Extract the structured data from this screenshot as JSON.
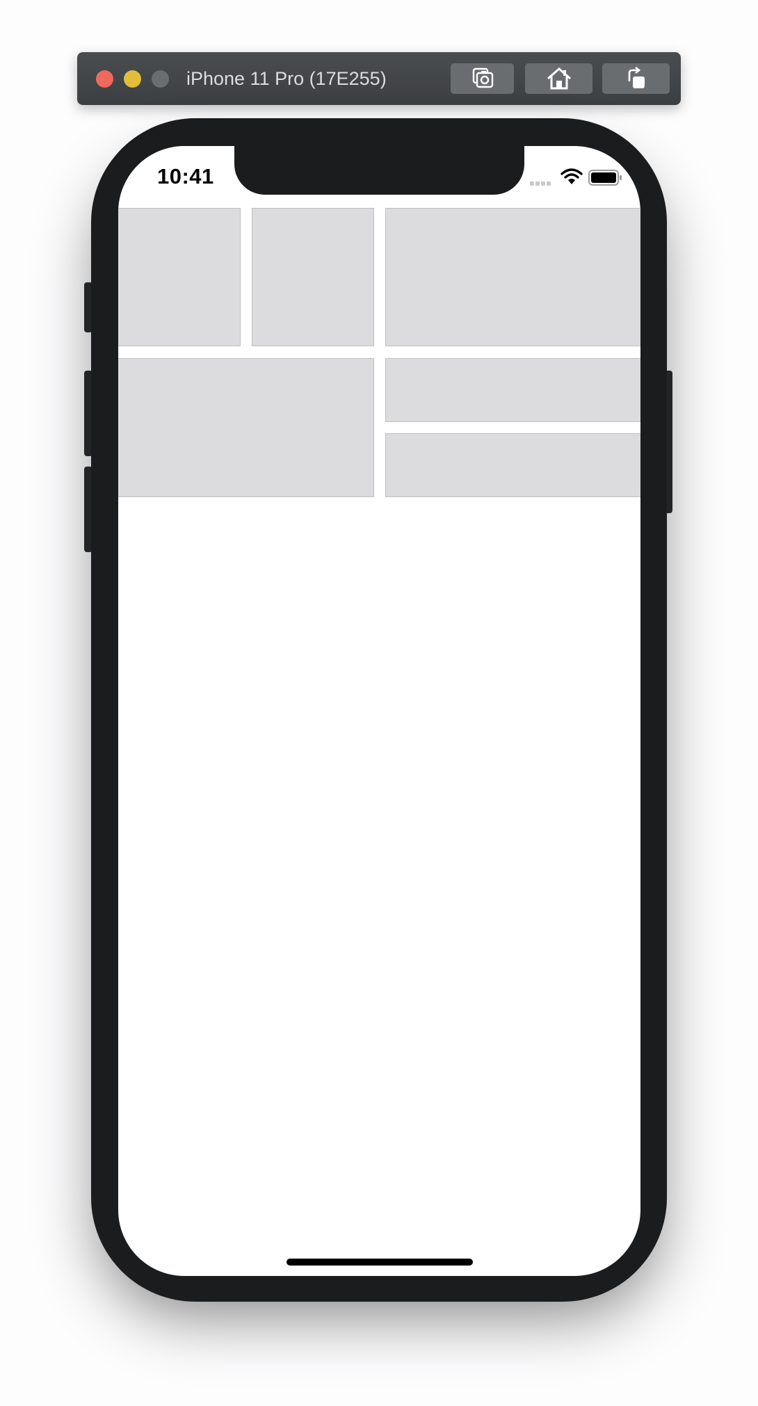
{
  "simulator": {
    "device_title": "iPhone 11 Pro (17E255)",
    "icons": [
      "close-icon",
      "minimize-icon",
      "zoom-icon",
      "camera-icon",
      "home-icon",
      "rotate-icon"
    ]
  },
  "status_bar": {
    "time": "10:41",
    "icons": [
      "signal-icon",
      "wifi-icon",
      "battery-icon"
    ]
  },
  "content": {
    "grid_cells": 6
  }
}
